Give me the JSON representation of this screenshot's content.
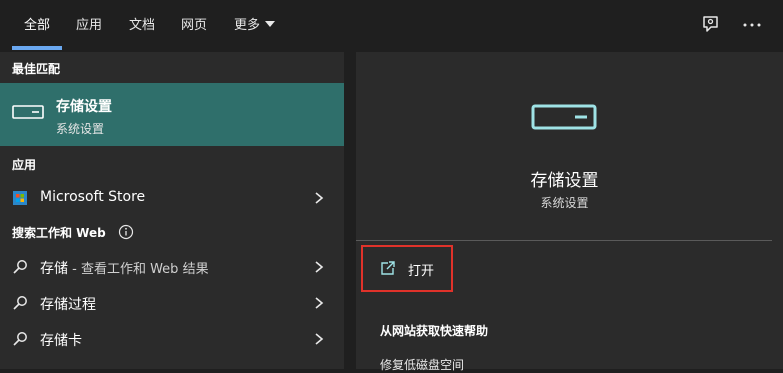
{
  "tabs": [
    {
      "label": "全部"
    },
    {
      "label": "应用"
    },
    {
      "label": "文档"
    },
    {
      "label": "网页"
    },
    {
      "label": "更多"
    }
  ],
  "left": {
    "best_match_header": "最佳匹配",
    "best_match": {
      "title": "存储设置",
      "subtitle": "系统设置",
      "icon": "drive-icon"
    },
    "apps_header": "应用",
    "apps": [
      {
        "label": "Microsoft Store",
        "icon": "store-icon"
      }
    ],
    "web_header": "搜索工作和 Web",
    "web_results": [
      {
        "term": "存储",
        "suffix": " - 查看工作和 Web 结果"
      },
      {
        "term": "存储过程",
        "suffix": ""
      },
      {
        "term": "存储卡",
        "suffix": ""
      }
    ]
  },
  "right": {
    "title": "存储设置",
    "subtitle": "系统设置",
    "open_label": "打开",
    "help_header": "从网站获取快速帮助",
    "help_link": "修复低磁盘空间"
  },
  "colors": {
    "accent": "#2f6f6b",
    "tab_underline": "#6aa8f0",
    "highlight_box": "#e0322a",
    "icon_teal": "#9fe3e6"
  }
}
